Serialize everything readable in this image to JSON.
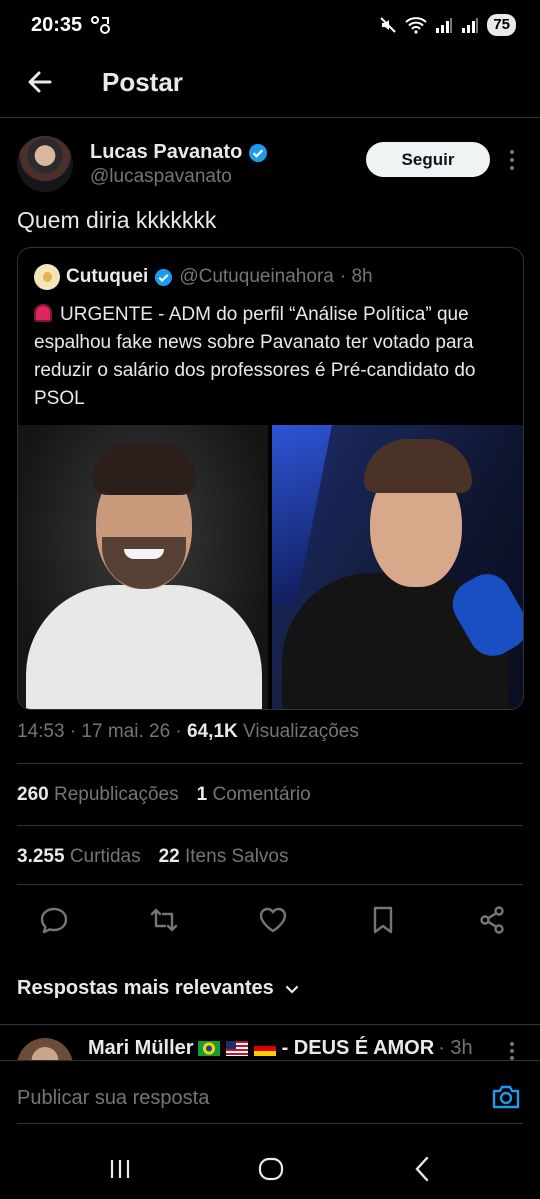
{
  "status_bar": {
    "time": "20:35",
    "battery": "75"
  },
  "header": {
    "title": "Postar"
  },
  "author": {
    "name": "Lucas Pavanato",
    "handle": "@lucaspavanato",
    "follow_label": "Seguir",
    "verified_icon": "verified-badge-icon"
  },
  "tweet": {
    "text": "Quem diria kkkkkkk"
  },
  "quote": {
    "name": "Cutuquei",
    "handle": "@Cutuqueinahora",
    "time": "· 8h",
    "body": "URGENTE - ADM do perfil “Análise Política” que espalhou fake news sobre Pavanato ter votado para reduzir o salário dos professores é Pré-candidato do PSOL",
    "siren_icon": "siren-emoji-icon"
  },
  "meta": {
    "time": "14:53",
    "date": "· 17 mai. 26 ·",
    "views_count": "64,1K",
    "views_label": "Visualizações"
  },
  "stats": {
    "reposts_count": "260",
    "reposts_label": "Republicações",
    "comments_count": "1",
    "comments_label": "Comentário",
    "likes_count": "3.255",
    "likes_label": "Curtidas",
    "saved_count": "22",
    "saved_label": "Itens Salvos"
  },
  "actions": [
    "reply-icon",
    "repost-icon",
    "like-icon",
    "bookmark-icon",
    "share-icon"
  ],
  "replies": {
    "sort_label": "Respostas mais relevantes",
    "first": {
      "name": "Mari Müller",
      "name_suffix": "- DEUS É AMOR",
      "time": "· 3h"
    }
  },
  "compose": {
    "placeholder": "Publicar sua resposta"
  },
  "colors": {
    "background": "#000000",
    "text": "#e7e9ea",
    "secondary": "#71767b",
    "accent": "#1d9bf0",
    "divider": "#2f3336"
  }
}
